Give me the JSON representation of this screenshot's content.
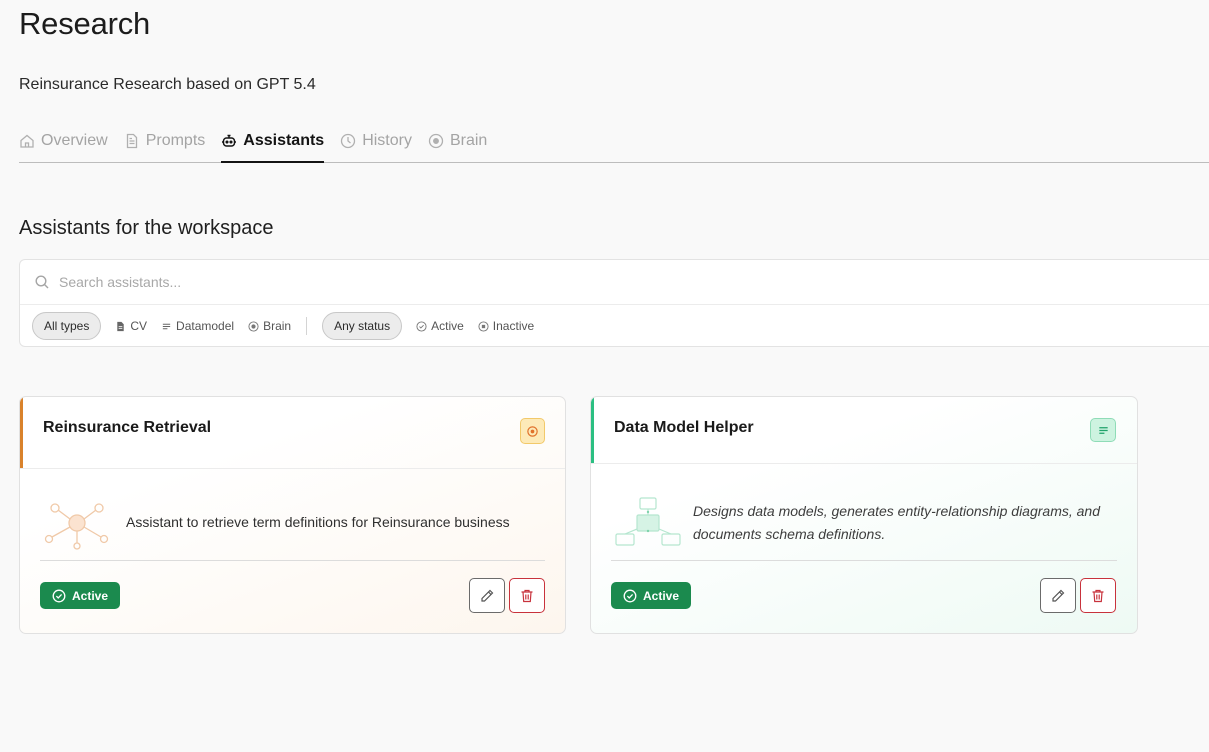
{
  "page": {
    "title": "Research",
    "subtitle": "Reinsurance Research based on GPT 5.4"
  },
  "tabs": [
    {
      "label": "Overview",
      "icon": "home-icon",
      "active": false
    },
    {
      "label": "Prompts",
      "icon": "document-icon",
      "active": false
    },
    {
      "label": "Assistants",
      "icon": "robot-icon",
      "active": true
    },
    {
      "label": "History",
      "icon": "clock-icon",
      "active": false
    },
    {
      "label": "Brain",
      "icon": "brain-icon",
      "active": false
    }
  ],
  "section": {
    "title": "Assistants for the workspace"
  },
  "search": {
    "placeholder": "Search assistants..."
  },
  "filters": {
    "types": [
      "All types",
      "CV",
      "Datamodel",
      "Brain"
    ],
    "statuses": [
      "Any status",
      "Active",
      "Inactive"
    ]
  },
  "assistants": [
    {
      "name": "Reinsurance Retrieval",
      "type_icon": "brain-icon",
      "accent_color": "#d9822b",
      "description": "Assistant to retrieve term definitions for Reinsurance business",
      "status": "Active"
    },
    {
      "name": "Data Model Helper",
      "type_icon": "datamodel-icon",
      "accent_color": "#2bbf82",
      "description": "Designs data models, generates entity-relationship diagrams, and documents schema definitions.",
      "status": "Active"
    }
  ],
  "colors": {
    "status_active": "#1b8a4e",
    "delete": "#c8323c"
  }
}
